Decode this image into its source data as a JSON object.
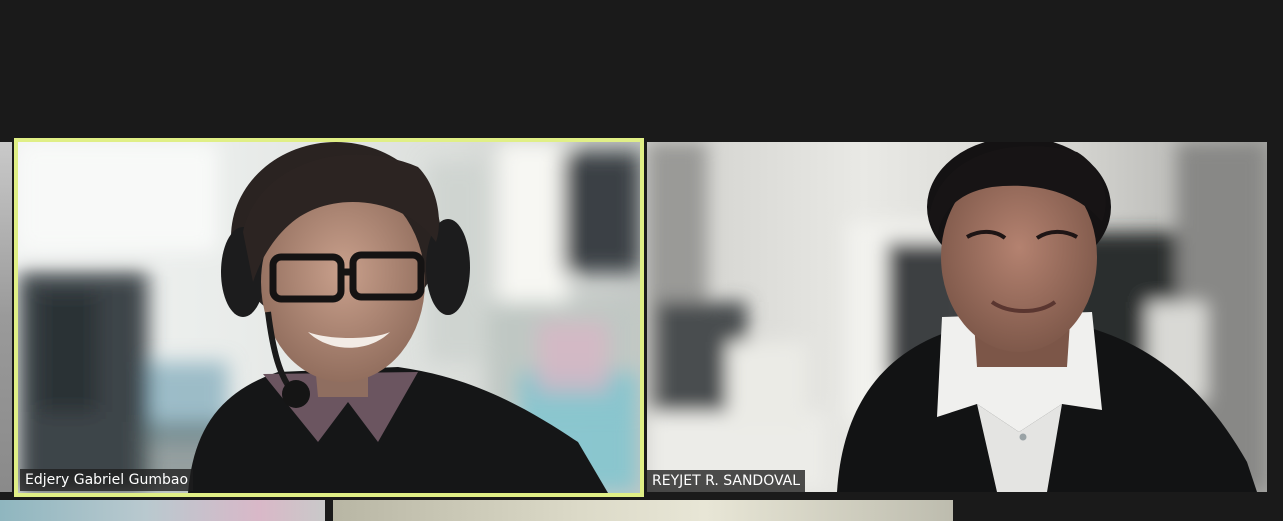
{
  "participants": [
    {
      "name": "Edjery Gabriel Gumbao",
      "active_speaker": true
    },
    {
      "name": "REYJET R. SANDOVAL",
      "active_speaker": false
    }
  ],
  "colors": {
    "background": "#1a1a1a",
    "active_speaker_border": "#e0ef86",
    "name_tag_bg": "#1e1e1e",
    "name_tag_text": "#ffffff"
  }
}
